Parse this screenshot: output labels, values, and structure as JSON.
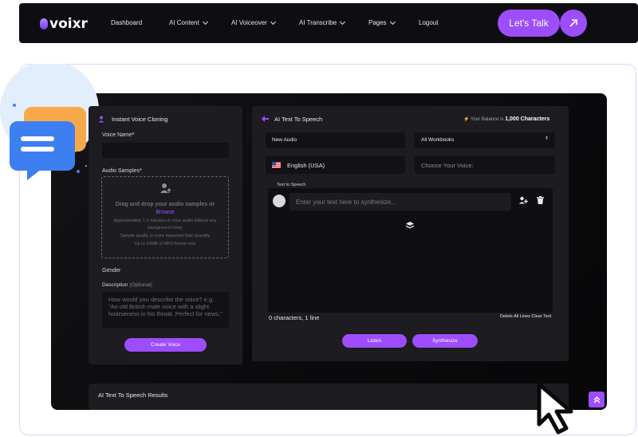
{
  "brand": {
    "logo": "voixr"
  },
  "nav": {
    "items": [
      {
        "label": "Dashboard"
      },
      {
        "label": "AI Content"
      },
      {
        "label": "AI Voiceover"
      },
      {
        "label": "AI Transcribe"
      },
      {
        "label": "Pages"
      },
      {
        "label": "Logout"
      }
    ],
    "cta": "Let's Talk"
  },
  "cloning": {
    "title": "Instant Voice Cloning",
    "voice_name_label": "Voice Name",
    "required": "*",
    "samples_label": "Audio Samples",
    "drop_line1": "Drag and drop your audio samples or",
    "browse": "Browse",
    "hint1": "Approximately 1-2 minutes of clear audio without any",
    "hint2": "background noise",
    "hint3": "Sample quality is more important than quantity",
    "hint4": "Up to 10MB of MP3 format only",
    "gender_label": "Gender",
    "description_label": "Description",
    "optional": "(Optional)",
    "description_placeholder": "How would you describe the voice? e.g. \"An old British male voice with a slight hoarseness in his throat. Perfect for news.\"",
    "create_button": "Create Voice"
  },
  "tts": {
    "title": "AI Text To Speech",
    "balance_prefix": "Your Balance is",
    "balance_value": "1,000 Characters",
    "audio_name": "New Audio",
    "workbook": "All Workbooks",
    "language": "English (USA)",
    "voice_placeholder": "Choose Your Voice:",
    "text_label": "Text to Speech",
    "text_placeholder": "Enter your text here to synthesize...",
    "counter": "0 characters, 1 line",
    "delete_all": "Delete All Lines",
    "clear_text": "Clear Text",
    "listen": "Listen",
    "synthesize": "Synthesize"
  },
  "results": {
    "title": "AI Text To Speech Results"
  },
  "colors": {
    "accent": "#9d4dfb",
    "panel": "#1c1c21",
    "app_bg": "#0b0b0d"
  },
  "icons": [
    "speech-bubbles-icon",
    "arrow-up-right-icon",
    "voice-user-icon",
    "back-arrow-icon",
    "bolt-icon",
    "us-flag-icon",
    "avatar-icon",
    "add-line-icon",
    "trash-icon",
    "stack-icon",
    "double-chevron-up-icon",
    "cursor-icon"
  ]
}
